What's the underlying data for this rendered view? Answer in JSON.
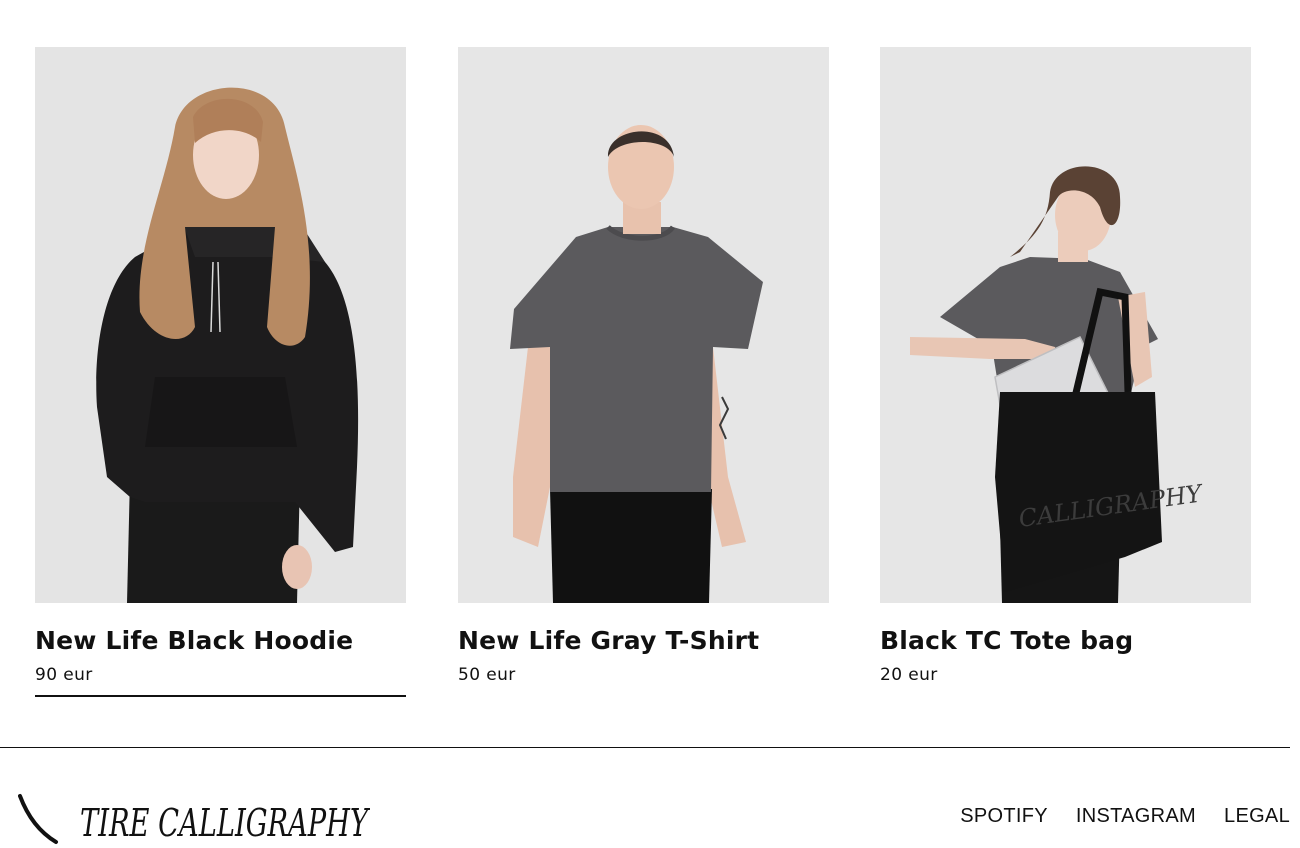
{
  "products": [
    {
      "title": "New Life Black Hoodie",
      "price": "90 eur"
    },
    {
      "title": "New Life Gray T-Shirt",
      "price": "50 eur"
    },
    {
      "title": "Black TC Tote bag",
      "price": "20 eur"
    }
  ],
  "footer": {
    "brand": "TIRE CALLIGRAPHY",
    "nav": {
      "spotify": "SPOTIFY",
      "instagram": "INSTAGRAM",
      "legal": "LEGAL"
    }
  },
  "colors": {
    "background": "#ffffff",
    "photo_backdrop": "#e6e6e6",
    "text": "#111111",
    "garment_black": "#1c1b1c",
    "garment_gray": "#5a5a5c"
  },
  "tote_print": "CALLIGRAPHY"
}
